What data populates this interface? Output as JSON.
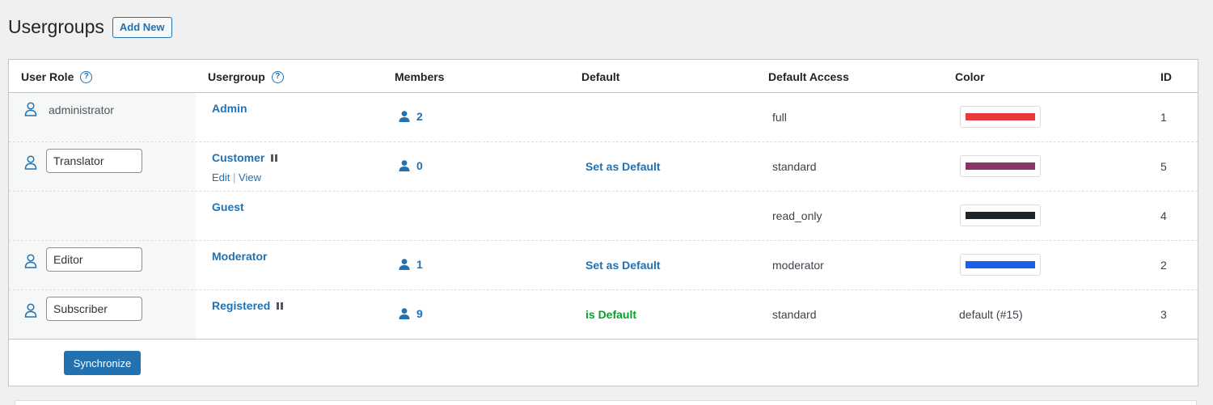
{
  "page": {
    "title": "Usergroups",
    "add_new_label": "Add New"
  },
  "columns": {
    "user_role": "User Role",
    "usergroup": "Usergroup",
    "members": "Members",
    "default": "Default",
    "default_access": "Default Access",
    "color": "Color",
    "id": "ID"
  },
  "help_glyph": "?",
  "rows": [
    {
      "role_text": "administrator",
      "group": "Admin",
      "members": "2",
      "default": "",
      "access": "full",
      "color": "#e83a3a",
      "id": "1"
    },
    {
      "role_value": "Translator",
      "group": "Customer",
      "edit_label": "Edit",
      "separator": "|",
      "view_label": "View",
      "members": "0",
      "default": "Set as Default",
      "access": "standard",
      "color": "#8b3566",
      "id": "5"
    },
    {
      "group": "Guest",
      "default": "",
      "access": "read_only",
      "color": "#1d2327",
      "id": "4"
    },
    {
      "role_value": "Editor",
      "group": "Moderator",
      "members": "1",
      "default": "Set as Default",
      "access": "moderator",
      "color": "#1b5fe8",
      "id": "2"
    },
    {
      "role_value": "Subscriber",
      "group": "Registered",
      "members": "9",
      "default": "is Default",
      "access": "standard",
      "color_text": "default (#15)",
      "id": "3"
    }
  ],
  "actions": {
    "synchronize_label": "Synchronize"
  },
  "icons": {
    "role": "user-outline-icon",
    "members": "user-solid-icon",
    "status": "pause-icon",
    "help": "help-circle-icon"
  }
}
